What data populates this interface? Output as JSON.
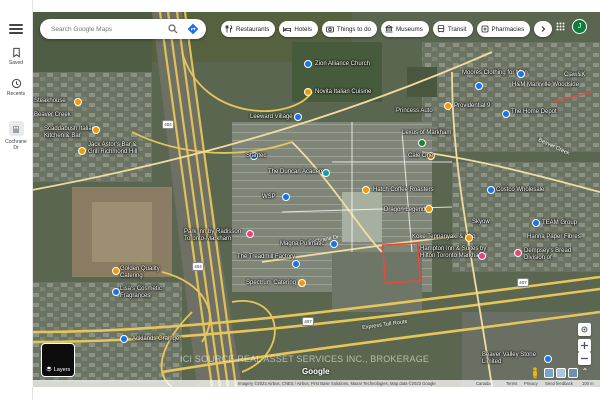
{
  "rail": {
    "saved": "Saved",
    "recents": "Recents",
    "active": "Cochrane Dr"
  },
  "search": {
    "placeholder": "Search Google Maps"
  },
  "chips": [
    {
      "label": "Restaurants",
      "icon": "fork-knife-icon"
    },
    {
      "label": "Hotels",
      "icon": "bed-icon"
    },
    {
      "label": "Things to do",
      "icon": "camera-icon"
    },
    {
      "label": "Museums",
      "icon": "museum-icon"
    },
    {
      "label": "Transit",
      "icon": "bus-icon"
    },
    {
      "label": "Pharmacies",
      "icon": "pill-icon"
    }
  ],
  "avatar": "J",
  "places": {
    "zion": "Zion Alliance Church",
    "novita": "Novita Italian Cuisine",
    "moores": "Moores Clothing for Men",
    "claw": "Claw&K",
    "hm": "H&M Markville Woodside",
    "provi": "Providential 9",
    "homedepot": "The Home Depot",
    "princess": "Princess Auto",
    "lexus": "Lexus of Markham",
    "steakhouse": "Steakhouse",
    "beaver_creek": "Beaver Creek",
    "scaddab": "Scaddabush Italian Kitchen & Bar",
    "jackastor": "Jack Astor's Bar & Grill Richmond Hill",
    "calepin": "Calé One",
    "stantec": "Stantec",
    "duncan": "The Duncan Academy",
    "hatch": "Hatch Coffee Roasters",
    "costco": "Costco Wholesale",
    "wsp": "WSP",
    "dragon": "Dragon Legend",
    "skyow": "Skyow",
    "team": "TEAM Group",
    "koke": "Koke Teppanyaki & Bbq",
    "hanna": "Hanna Paper Fibres",
    "dempsey": "Dempsey's Bread Division of",
    "parkinn": "Park Inn by Radisson Toronto-Markham",
    "magna": "Magna Pullmatic",
    "hampton": "Hampton Inn & Suites by Hilton Toronto Markham",
    "treadmill": "The Treadmill Factory",
    "spectrum": "Spectrum Catering",
    "golden": "Golden Quality Catering",
    "lisas": "Lisa's Cosmetic Fragrances",
    "ackland": "Acklands Grainger",
    "beaver_valley": "Beaver Valley Stone Limited",
    "leeward": "Leeward Village"
  },
  "roads": {
    "cochrane": "Cochrane Dr",
    "beaver_creek_rd": "Beaver Creek",
    "express": "Express Toll Route"
  },
  "watermark": "ICI SOURCE REAL ASSET SERVICES INC., BROKERAGE",
  "brand": "Google",
  "layers": "Layers",
  "footer": {
    "attribution": "Imagery ©2023 Airbus, CNES / Airbus, First Base Solutions, Maxar Technologies, Map data ©2023 Google",
    "canada": "Canada",
    "terms": "Terms",
    "privacy": "Privacy",
    "feedback": "Send feedback",
    "scale": "100 m"
  }
}
